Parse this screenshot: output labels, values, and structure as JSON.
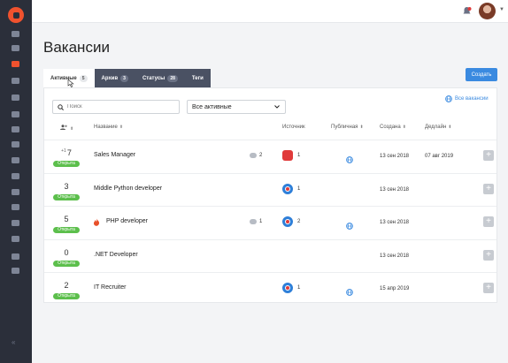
{
  "header": {
    "title": "Вакансии",
    "create_label": "Создать"
  },
  "sidebar": {
    "icons": [
      "feather-icon",
      "briefcase-icon",
      "document-icon",
      "user-icon",
      "user-add-icon",
      "users-icon",
      "person-icon",
      "circle-icon",
      "flag-icon",
      "calendar-icon",
      "video-icon",
      "chart-icon",
      "chat-icon",
      "bell-icon",
      "gear-icon",
      "help-icon"
    ],
    "active_index": 2,
    "collapse_label": "«"
  },
  "tabs": [
    {
      "label": "Активные",
      "count": "5"
    },
    {
      "label": "Архив",
      "count": "3"
    },
    {
      "label": "Статусы",
      "count": "28"
    },
    {
      "label": "Теги",
      "count": ""
    }
  ],
  "filters": {
    "search_placeholder": "Поиск",
    "status_select": "Все активные",
    "all_vacancies_link": "Все вакансии"
  },
  "columns": {
    "candidates": "",
    "name": "Название",
    "source": "Источник",
    "public": "Публичная",
    "created": "Создана",
    "deadline": "Дедлайн"
  },
  "rows": [
    {
      "delta": "+1",
      "count": "7",
      "status": "Открыта",
      "name": "Sales Manager",
      "hot": false,
      "comments": "2",
      "source_type": "red",
      "source_count": "1",
      "public": true,
      "created": "13 сен 2018",
      "deadline": "07 авг 2019"
    },
    {
      "delta": "",
      "count": "3",
      "status": "Открыта",
      "name": "Middle Python developer",
      "hot": false,
      "comments": "",
      "source_type": "blue",
      "source_count": "1",
      "public": false,
      "created": "13 сен 2018",
      "deadline": ""
    },
    {
      "delta": "",
      "count": "5",
      "status": "Открыта",
      "name": "PHP developer",
      "hot": true,
      "comments": "1",
      "source_type": "blue",
      "source_count": "2",
      "public": true,
      "created": "13 сен 2018",
      "deadline": ""
    },
    {
      "delta": "",
      "count": "0",
      "status": "Открыта",
      "name": ".NET Developer",
      "hot": false,
      "comments": "",
      "source_type": "",
      "source_count": "",
      "public": false,
      "created": "13 сен 2018",
      "deadline": ""
    },
    {
      "delta": "",
      "count": "2",
      "status": "Открыта",
      "name": "IT Recruiter",
      "hot": false,
      "comments": "",
      "source_type": "blue",
      "source_count": "1",
      "public": true,
      "created": "15 апр 2019",
      "deadline": ""
    }
  ],
  "colors": {
    "sidebar_bg": "#2b2f3a",
    "accent": "#f0522e",
    "primary": "#3a8ae0",
    "status_open": "#5cbf4c"
  }
}
